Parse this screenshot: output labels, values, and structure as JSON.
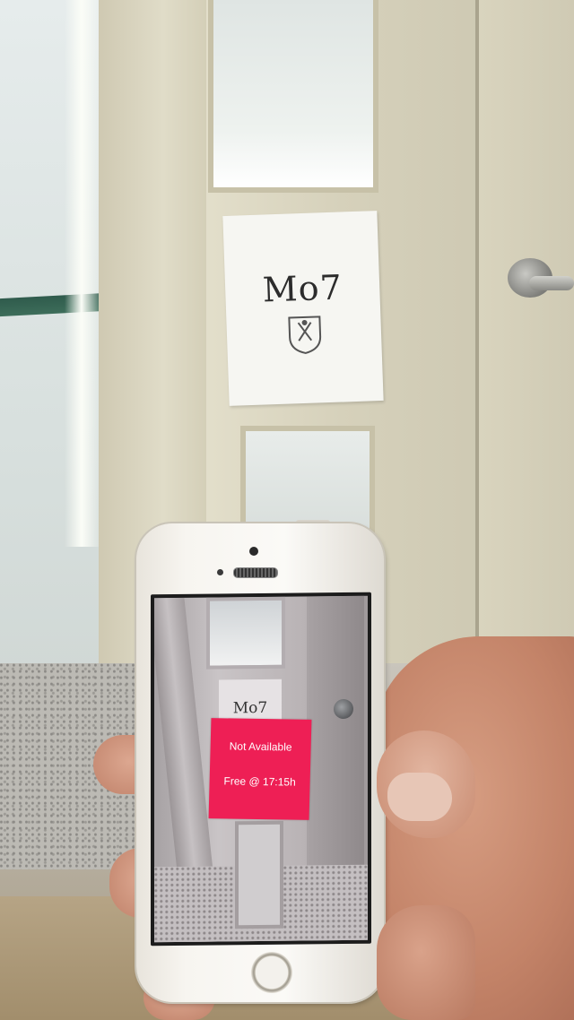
{
  "scene": {
    "sign": {
      "room_label": "Mo7"
    },
    "phone": {
      "camera_view": {
        "sign_label": "Mo7"
      },
      "ar_overlay": {
        "status": "Not Available",
        "free_time": "Free @ 17:15h",
        "color": "#ee1f55"
      }
    }
  }
}
